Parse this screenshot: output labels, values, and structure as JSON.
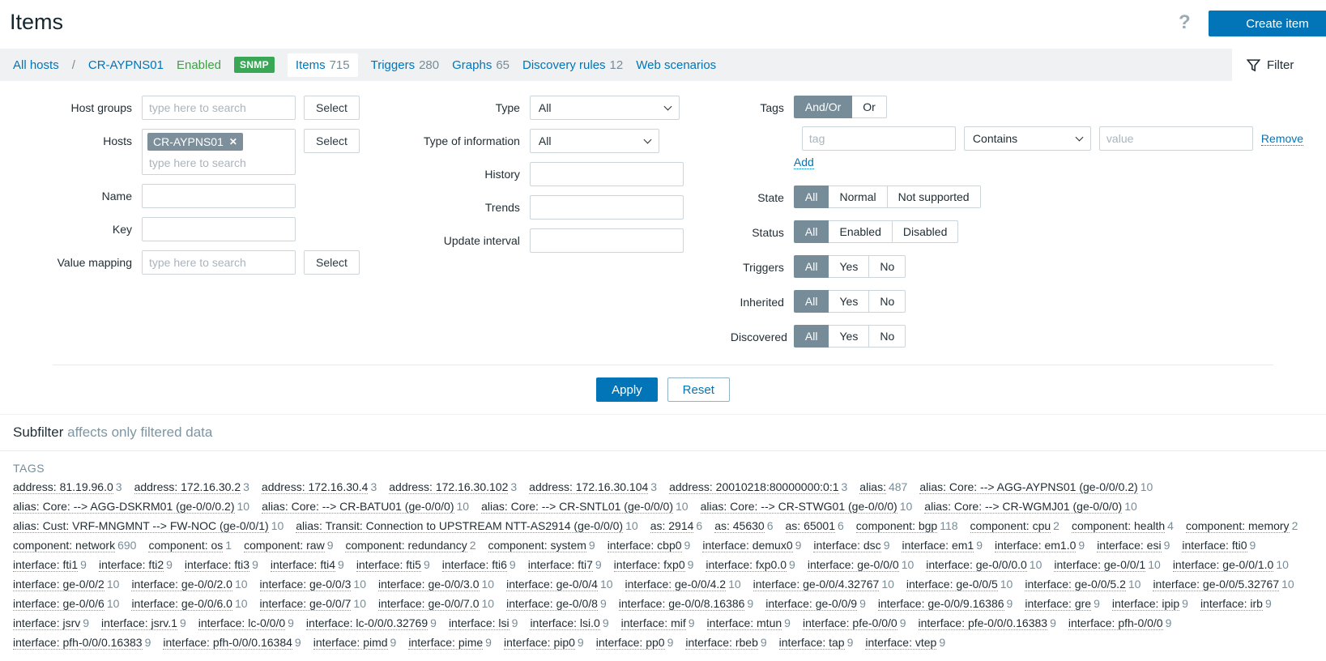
{
  "page": {
    "title": "Items"
  },
  "header": {
    "help_icon": "?",
    "create_button": "Create item"
  },
  "nav": {
    "all_hosts": "All hosts",
    "separator": "/",
    "host": "CR-AYPNS01",
    "enabled": "Enabled",
    "snmp_badge": "SNMP",
    "tabs": {
      "items": {
        "label": "Items",
        "count": "715"
      },
      "triggers": {
        "label": "Triggers",
        "count": "280"
      },
      "graphs": {
        "label": "Graphs",
        "count": "65"
      },
      "discovery": {
        "label": "Discovery rules",
        "count": "12"
      },
      "web": {
        "label": "Web scenarios"
      }
    },
    "filter_tab": "Filter"
  },
  "filter": {
    "host_groups": {
      "label": "Host groups",
      "placeholder": "type here to search",
      "select_button": "Select"
    },
    "hosts": {
      "label": "Hosts",
      "chip": "CR-AYPNS01",
      "chip_remove": "✕",
      "placeholder": "type here to search",
      "select_button": "Select"
    },
    "name": {
      "label": "Name",
      "value": ""
    },
    "key": {
      "label": "Key",
      "value": ""
    },
    "value_mapping": {
      "label": "Value mapping",
      "placeholder": "type here to search",
      "select_button": "Select"
    },
    "type": {
      "label": "Type",
      "value": "All"
    },
    "type_of_information": {
      "label": "Type of information",
      "value": "All"
    },
    "history": {
      "label": "History",
      "value": ""
    },
    "trends": {
      "label": "Trends",
      "value": ""
    },
    "update_interval": {
      "label": "Update interval",
      "value": ""
    },
    "tags": {
      "label": "Tags",
      "operator_andor": "And/Or",
      "operator_or": "Or",
      "selected_operator": "And/Or",
      "tag_placeholder": "tag",
      "match_operator": "Contains",
      "value_placeholder": "value",
      "remove_link": "Remove",
      "add_link": "Add"
    },
    "state": {
      "label": "State",
      "options": [
        "All",
        "Normal",
        "Not supported"
      ],
      "selected": "All"
    },
    "status": {
      "label": "Status",
      "options": [
        "All",
        "Enabled",
        "Disabled"
      ],
      "selected": "All"
    },
    "triggers": {
      "label": "Triggers",
      "options": [
        "All",
        "Yes",
        "No"
      ],
      "selected": "All"
    },
    "inherited": {
      "label": "Inherited",
      "options": [
        "All",
        "Yes",
        "No"
      ],
      "selected": "All"
    },
    "discovered": {
      "label": "Discovered",
      "options": [
        "All",
        "Yes",
        "No"
      ],
      "selected": "All"
    },
    "apply_button": "Apply",
    "reset_button": "Reset"
  },
  "subfilter": {
    "title": "Subfilter",
    "subtitle": "affects only filtered data",
    "tags_header": "TAGS",
    "tags": [
      {
        "t": "address: 81.19.96.0",
        "c": "3"
      },
      {
        "t": "address: 172.16.30.2",
        "c": "3"
      },
      {
        "t": "address: 172.16.30.4",
        "c": "3"
      },
      {
        "t": "address: 172.16.30.102",
        "c": "3"
      },
      {
        "t": "address: 172.16.30.104",
        "c": "3"
      },
      {
        "t": "address: 20010218:80000000:0:1",
        "c": "3"
      },
      {
        "t": "alias:",
        "c": "487"
      },
      {
        "t": "alias: Core: --> AGG-AYPNS01 (ge-0/0/0.2)",
        "c": "10"
      },
      {
        "t": "alias: Core: --> AGG-DSKRM01 (ge-0/0/0.2)",
        "c": "10"
      },
      {
        "t": "alias: Core: --> CR-BATU01 (ge-0/0/0)",
        "c": "10"
      },
      {
        "t": "alias: Core: --> CR-SNTL01 (ge-0/0/0)",
        "c": "10"
      },
      {
        "t": "alias: Core: --> CR-STWG01 (ge-0/0/0)",
        "c": "10"
      },
      {
        "t": "alias: Core: --> CR-WGMJ01 (ge-0/0/0)",
        "c": "10"
      },
      {
        "t": "alias: Cust: VRF-MNGMNT --> FW-NOC (ge-0/0/1)",
        "c": "10"
      },
      {
        "t": "alias: Transit: Connection to UPSTREAM NTT-AS2914 (ge-0/0/0)",
        "c": "10"
      },
      {
        "t": "as: 2914",
        "c": "6"
      },
      {
        "t": "as: 45630",
        "c": "6"
      },
      {
        "t": "as: 65001",
        "c": "6"
      },
      {
        "t": "component: bgp",
        "c": "118"
      },
      {
        "t": "component: cpu",
        "c": "2"
      },
      {
        "t": "component: health",
        "c": "4"
      },
      {
        "t": "component: memory",
        "c": "2"
      },
      {
        "t": "component: network",
        "c": "690"
      },
      {
        "t": "component: os",
        "c": "1"
      },
      {
        "t": "component: raw",
        "c": "9"
      },
      {
        "t": "component: redundancy",
        "c": "2"
      },
      {
        "t": "component: system",
        "c": "9"
      },
      {
        "t": "interface: cbp0",
        "c": "9"
      },
      {
        "t": "interface: demux0",
        "c": "9"
      },
      {
        "t": "interface: dsc",
        "c": "9"
      },
      {
        "t": "interface: em1",
        "c": "9"
      },
      {
        "t": "interface: em1.0",
        "c": "9"
      },
      {
        "t": "interface: esi",
        "c": "9"
      },
      {
        "t": "interface: fti0",
        "c": "9"
      },
      {
        "t": "interface: fti1",
        "c": "9"
      },
      {
        "t": "interface: fti2",
        "c": "9"
      },
      {
        "t": "interface: fti3",
        "c": "9"
      },
      {
        "t": "interface: fti4",
        "c": "9"
      },
      {
        "t": "interface: fti5",
        "c": "9"
      },
      {
        "t": "interface: fti6",
        "c": "9"
      },
      {
        "t": "interface: fti7",
        "c": "9"
      },
      {
        "t": "interface: fxp0",
        "c": "9"
      },
      {
        "t": "interface: fxp0.0",
        "c": "9"
      },
      {
        "t": "interface: ge-0/0/0",
        "c": "10"
      },
      {
        "t": "interface: ge-0/0/0.0",
        "c": "10"
      },
      {
        "t": "interface: ge-0/0/1",
        "c": "10"
      },
      {
        "t": "interface: ge-0/0/1.0",
        "c": "10"
      },
      {
        "t": "interface: ge-0/0/2",
        "c": "10"
      },
      {
        "t": "interface: ge-0/0/2.0",
        "c": "10"
      },
      {
        "t": "interface: ge-0/0/3",
        "c": "10"
      },
      {
        "t": "interface: ge-0/0/3.0",
        "c": "10"
      },
      {
        "t": "interface: ge-0/0/4",
        "c": "10"
      },
      {
        "t": "interface: ge-0/0/4.2",
        "c": "10"
      },
      {
        "t": "interface: ge-0/0/4.32767",
        "c": "10"
      },
      {
        "t": "interface: ge-0/0/5",
        "c": "10"
      },
      {
        "t": "interface: ge-0/0/5.2",
        "c": "10"
      },
      {
        "t": "interface: ge-0/0/5.32767",
        "c": "10"
      },
      {
        "t": "interface: ge-0/0/6",
        "c": "10"
      },
      {
        "t": "interface: ge-0/0/6.0",
        "c": "10"
      },
      {
        "t": "interface: ge-0/0/7",
        "c": "10"
      },
      {
        "t": "interface: ge-0/0/7.0",
        "c": "10"
      },
      {
        "t": "interface: ge-0/0/8",
        "c": "9"
      },
      {
        "t": "interface: ge-0/0/8.16386",
        "c": "9"
      },
      {
        "t": "interface: ge-0/0/9",
        "c": "9"
      },
      {
        "t": "interface: ge-0/0/9.16386",
        "c": "9"
      },
      {
        "t": "interface: gre",
        "c": "9"
      },
      {
        "t": "interface: ipip",
        "c": "9"
      },
      {
        "t": "interface: irb",
        "c": "9"
      },
      {
        "t": "interface: jsrv",
        "c": "9"
      },
      {
        "t": "interface: jsrv.1",
        "c": "9"
      },
      {
        "t": "interface: lc-0/0/0",
        "c": "9"
      },
      {
        "t": "interface: lc-0/0/0.32769",
        "c": "9"
      },
      {
        "t": "interface: lsi",
        "c": "9"
      },
      {
        "t": "interface: lsi.0",
        "c": "9"
      },
      {
        "t": "interface: mif",
        "c": "9"
      },
      {
        "t": "interface: mtun",
        "c": "9"
      },
      {
        "t": "interface: pfe-0/0/0",
        "c": "9"
      },
      {
        "t": "interface: pfe-0/0/0.16383",
        "c": "9"
      },
      {
        "t": "interface: pfh-0/0/0",
        "c": "9"
      },
      {
        "t": "interface: pfh-0/0/0.16383",
        "c": "9"
      },
      {
        "t": "interface: pfh-0/0/0.16384",
        "c": "9"
      },
      {
        "t": "interface: pimd",
        "c": "9"
      },
      {
        "t": "interface: pime",
        "c": "9"
      },
      {
        "t": "interface: pip0",
        "c": "9"
      },
      {
        "t": "interface: pp0",
        "c": "9"
      },
      {
        "t": "interface: rbeb",
        "c": "9"
      },
      {
        "t": "interface: tap",
        "c": "9"
      },
      {
        "t": "interface: vtep",
        "c": "9"
      }
    ]
  },
  "colors": {
    "accent_blue": "#0275b8",
    "status_green": "#429e47",
    "snmp_badge_green": "#3aa756",
    "segment_selected_gray": "#768d99",
    "navbar_bg": "#f0f1f2"
  }
}
